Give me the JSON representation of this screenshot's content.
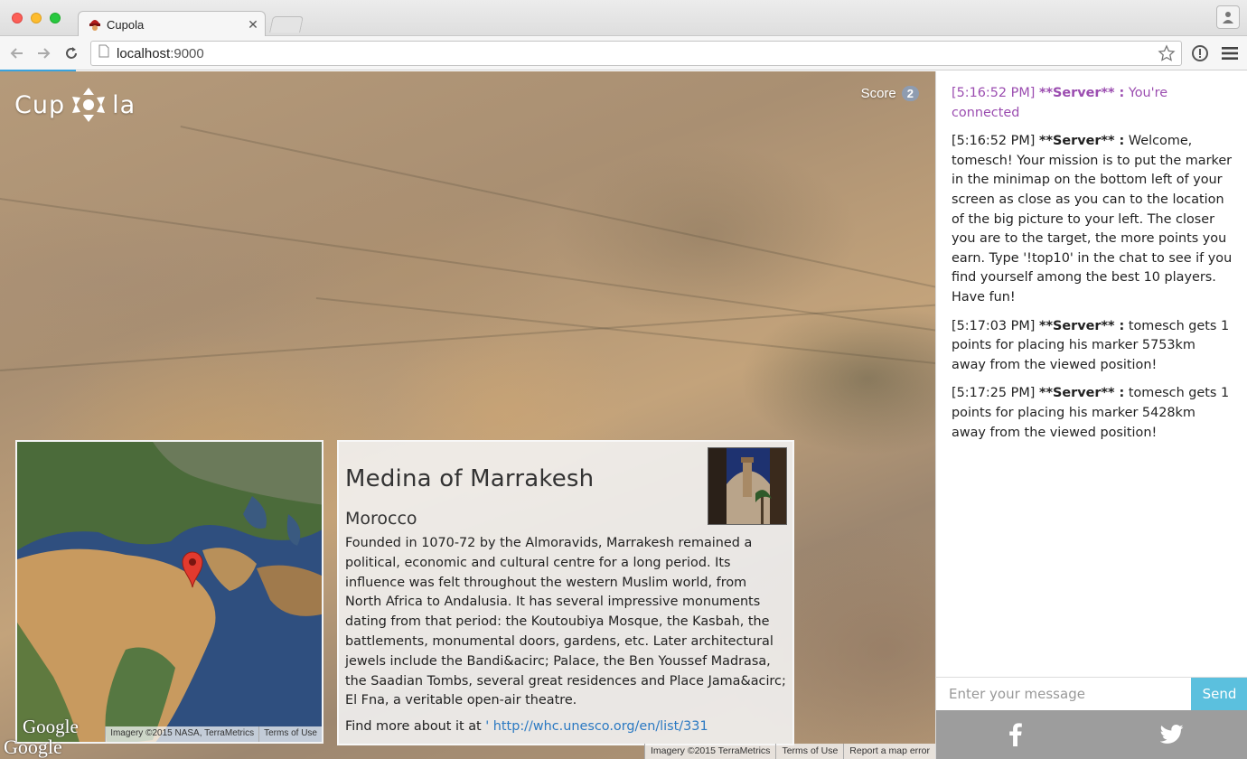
{
  "browser": {
    "tab_title": "Cupola",
    "url_host": "localhost",
    "url_port": ":9000"
  },
  "app": {
    "logo_left": "Cup",
    "logo_right": "la",
    "score_label": "Score",
    "score_value": "2"
  },
  "minimap": {
    "google_label": "Google",
    "credits": [
      "Imagery ©2015 NASA, TerraMetrics",
      "Terms of Use"
    ]
  },
  "info": {
    "title": "Medina of Marrakesh",
    "country": "Morocco",
    "description": "Founded in 1070-72 by the Almoravids, Marrakesh remained a political, economic and cultural centre for a long period. Its influence was felt throughout the western Muslim world, from North Africa to Andalusia. It has several impressive monuments dating from that period: the Koutoubiya Mosque, the Kasbah, the battlements, monumental doors, gardens, etc. Later architectural jewels include the Bandi&acirc; Palace, the Ben Youssef Madrasa, the Saadian Tombs, several great residences and Place Jama&acirc; El Fna, a veritable open-air theatre.",
    "link_prefix": "Find more about it at ",
    "link_text": "' http://whc.unesco.org/en/list/331"
  },
  "map_bottom": {
    "google_label": "Google",
    "credits": [
      "Imagery ©2015 TerraMetrics",
      "Terms of Use",
      "Report a map error"
    ]
  },
  "chat": {
    "messages": [
      {
        "time": "[5:16:52 PM]",
        "sender": "**Server** :",
        "text": "You're connected",
        "type": "system"
      },
      {
        "time": "[5:16:52 PM]",
        "sender": "**Server** :",
        "text": "Welcome, tomesch! Your mission is to put the marker in the minimap on the bottom left of your screen as close as you can to the location of the big picture to your left. The closer you are to the target, the more points you earn. Type '!top10' in the chat to see if you find yourself among the best 10 players. Have fun!",
        "type": "normal"
      },
      {
        "time": "[5:17:03 PM]",
        "sender": "**Server** :",
        "text": "tomesch gets 1 points for placing his marker 5753km away from the viewed position!",
        "type": "normal"
      },
      {
        "time": "[5:17:25 PM]",
        "sender": "**Server** :",
        "text": "tomesch gets 1 points for placing his marker 5428km away from the viewed position!",
        "type": "normal"
      }
    ],
    "input_placeholder": "Enter your message",
    "send_label": "Send"
  },
  "social": {
    "icons": [
      "facebook-icon",
      "twitter-icon"
    ]
  },
  "colors": {
    "accent": "#5bc0de",
    "system_message": "#9b4db0",
    "link": "#2b79c2"
  }
}
